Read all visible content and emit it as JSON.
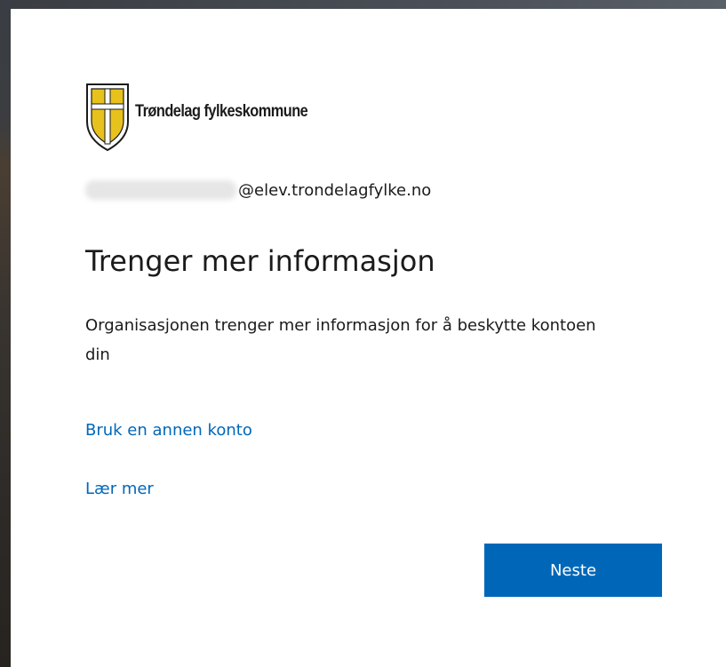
{
  "organization": {
    "name": "Trøndelag fylkeskommune",
    "logo_icon": "county-shield-icon"
  },
  "identity": {
    "username_redacted": true,
    "domain": "@elev.trondelagfylke.no"
  },
  "main": {
    "title": "Trenger mer informasjon",
    "description": "Organisasjonen trenger mer informasjon for å beskytte kontoen din"
  },
  "links": {
    "use_other_account": "Bruk en annen konto",
    "learn_more": "Lær mer"
  },
  "actions": {
    "next_label": "Neste"
  },
  "colors": {
    "accent": "#0067b8",
    "shield_gold": "#e8c21c",
    "text": "#1b1b1b"
  }
}
